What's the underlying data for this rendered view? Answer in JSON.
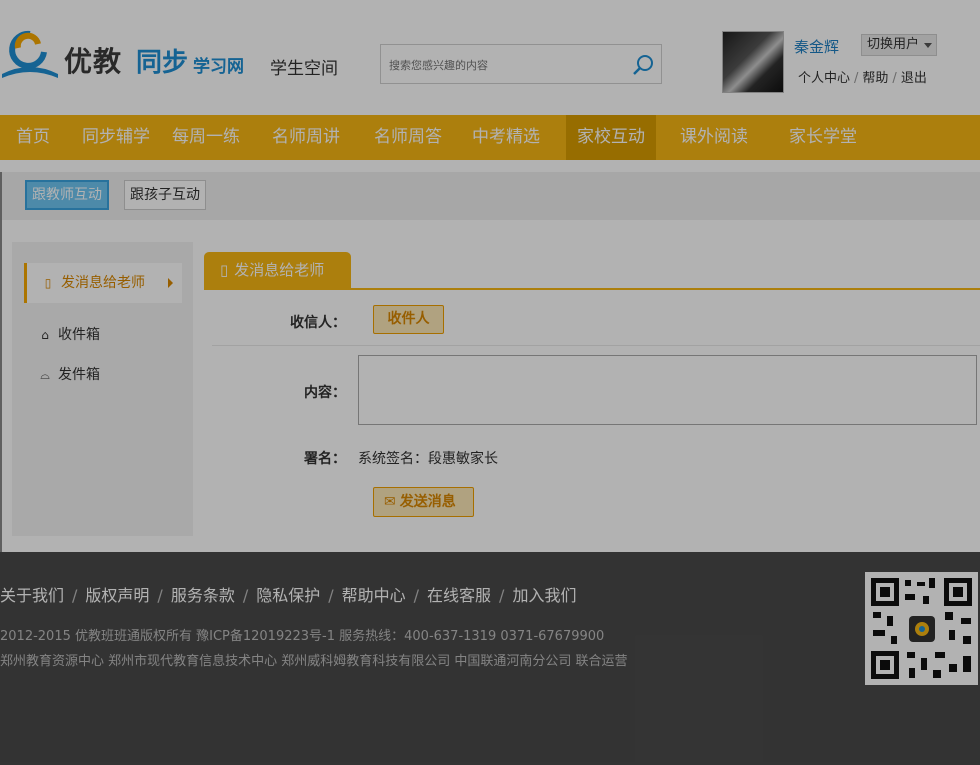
{
  "header": {
    "logo_text_1": "优教",
    "logo_text_2": "同步",
    "logo_text_3": "学习网",
    "site_subtitle": "学生空间",
    "search_placeholder": "搜索您感兴趣的内容",
    "username": "秦金辉",
    "switch_user_label": "切换用户",
    "links": [
      "个人中心",
      "帮助",
      "退出"
    ]
  },
  "nav": {
    "items": [
      "首页",
      "同步辅学",
      "每周一练",
      "名师周讲",
      "名师周答",
      "中考精选",
      "家校互动",
      "课外阅读",
      "家长学堂"
    ],
    "active": "家校互动"
  },
  "subtabs": {
    "items": [
      "跟教师互动",
      "跟孩子互动"
    ],
    "active": "跟教师互动"
  },
  "sidebar": {
    "items": [
      {
        "label": "发消息给老师",
        "icon": "phone-icon"
      },
      {
        "label": "收件箱",
        "icon": "inbox-icon"
      },
      {
        "label": "发件箱",
        "icon": "outbox-icon"
      }
    ]
  },
  "panel": {
    "title": "发消息给老师",
    "recipient_label": "收信人：",
    "recipient_button": "收件人",
    "content_label": "内容：",
    "signature_label": "署名：",
    "signature_value": "系统签名：段惠敏家长",
    "send_button": "发送消息"
  },
  "footer": {
    "links": [
      "关于我们",
      "版权声明",
      "服务条款",
      "隐私保护",
      "帮助中心",
      "在线客服",
      "加入我们"
    ],
    "copyright": "2012-2015 优教班班通版权所有  豫ICP备12019223号-1     服务热线：400-637-1319   0371-67679900",
    "operators": "郑州教育资源中心     郑州市现代教育信息技术中心    郑州威科姆教育科技有限公司  中国联通河南分公司   联合运营"
  },
  "colors": {
    "brand_orange": "#f6b613",
    "brand_blue": "#1f8fd3",
    "footer_bg": "#4a4a4a"
  }
}
